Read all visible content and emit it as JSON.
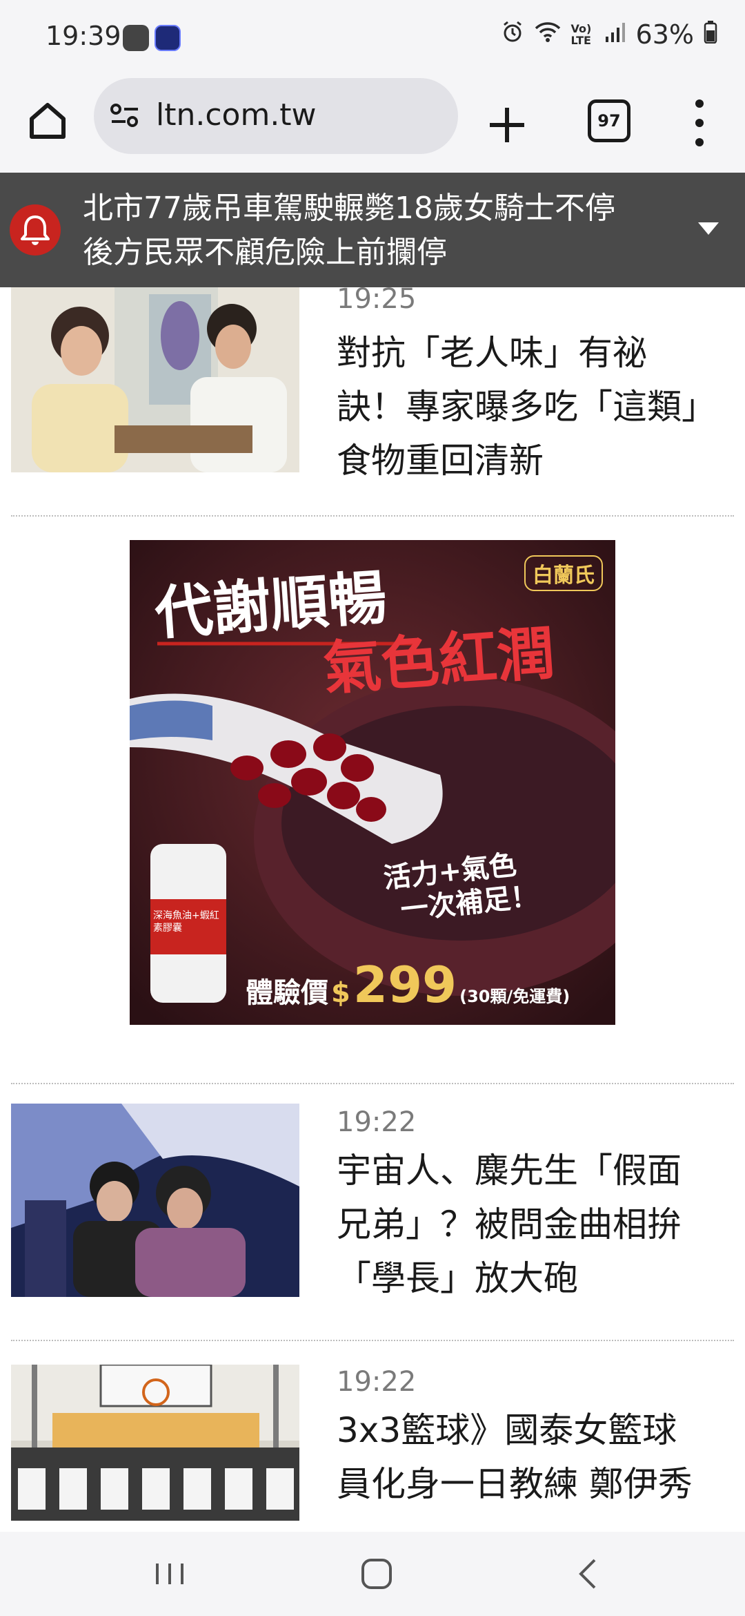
{
  "status_bar": {
    "time": "19:39",
    "battery": "63%",
    "network": "Vo) LTE"
  },
  "browser": {
    "url": "ltn.com.tw",
    "tab_count": "97"
  },
  "breaking_news": {
    "line1": "北市77歲吊車駕駛輾斃18歲女騎士不停",
    "line2": "後方民眾不顧危險上前攔停"
  },
  "articles": [
    {
      "time": "19:25",
      "title_lines": [
        "對抗「老人味」有祕",
        "訣！專家曝多吃「這類」",
        "食物重回清新"
      ]
    },
    {
      "time": "19:22",
      "title_lines": [
        "宇宙人、麋先生「假面",
        "兄弟」？被問金曲相拚",
        "「學長」放大砲"
      ]
    },
    {
      "time": "19:22",
      "title_lines": [
        "3x3籃球》國泰女籃球",
        "員化身一日教練 鄭伊秀"
      ]
    }
  ],
  "ad": {
    "brand": "白蘭氏",
    "headline1": "代謝順暢",
    "headline2": "氣色紅潤",
    "tagline1": "活力+氣色",
    "tagline2": "一次補足！",
    "price_label": "體驗價",
    "price_currency": "$",
    "price_value": "299",
    "price_note": "(30顆/免運費)",
    "product_label": "深海魚油+蝦紅素膠囊"
  },
  "colors": {
    "accent_red": "#c8241f",
    "banner_bg": "#4a4a4a",
    "ad_gold": "#f0c85a"
  }
}
